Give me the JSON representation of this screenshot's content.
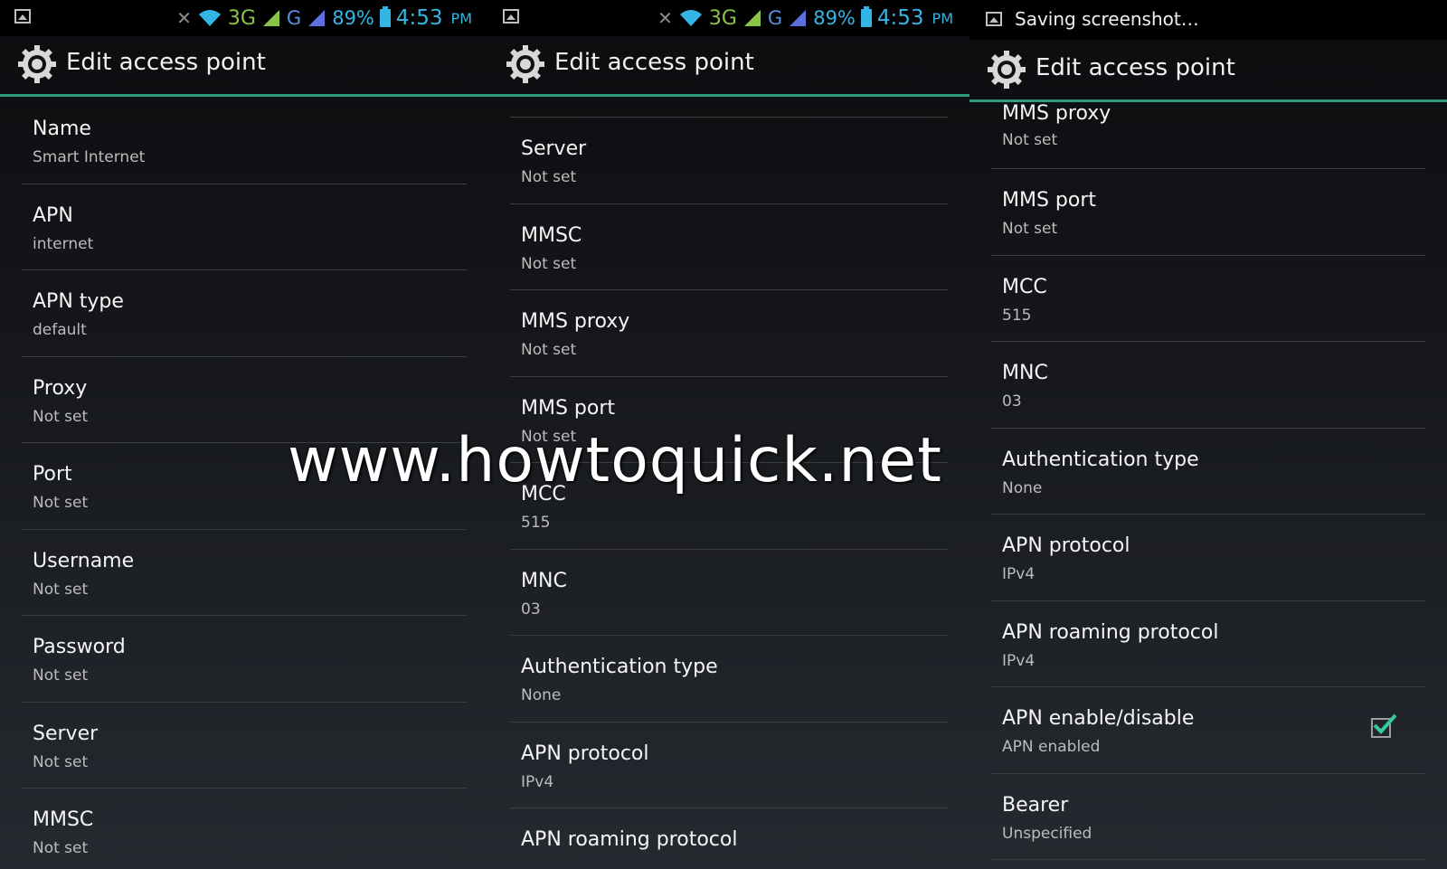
{
  "panels": [
    {
      "status": {
        "bt": "3G",
        "g": "G",
        "battery": "89%",
        "time": "4:53",
        "ampm": "PM"
      },
      "title": "Edit access point",
      "items": [
        {
          "title": "Name",
          "sub": "Smart Internet"
        },
        {
          "title": "APN",
          "sub": "internet"
        },
        {
          "title": "APN type",
          "sub": "default"
        },
        {
          "title": "Proxy",
          "sub": "Not set"
        },
        {
          "title": "Port",
          "sub": "Not set"
        },
        {
          "title": "Username",
          "sub": "Not set"
        },
        {
          "title": "Password",
          "sub": "Not set"
        },
        {
          "title": "Server",
          "sub": "Not set"
        },
        {
          "title": "MMSC",
          "sub": "Not set"
        }
      ]
    },
    {
      "status": {
        "bt": "3G",
        "g": "G",
        "battery": "89%",
        "time": "4:53",
        "ampm": "PM"
      },
      "title": "Edit access point",
      "items": [
        {
          "title": "Server",
          "sub": "Not set"
        },
        {
          "title": "MMSC",
          "sub": "Not set"
        },
        {
          "title": "MMS proxy",
          "sub": "Not set"
        },
        {
          "title": "MMS port",
          "sub": "Not set"
        },
        {
          "title": "MCC",
          "sub": "515"
        },
        {
          "title": "MNC",
          "sub": "03"
        },
        {
          "title": "Authentication type",
          "sub": "None"
        },
        {
          "title": "APN protocol",
          "sub": "IPv4"
        },
        {
          "title": "APN roaming protocol",
          "sub": ""
        }
      ]
    },
    {
      "status": {
        "saving": "Saving screenshot…"
      },
      "title": "Edit access point",
      "items": [
        {
          "title": "MMS proxy",
          "sub": "Not set"
        },
        {
          "title": "MMS port",
          "sub": "Not set"
        },
        {
          "title": "MCC",
          "sub": "515"
        },
        {
          "title": "MNC",
          "sub": "03"
        },
        {
          "title": "Authentication type",
          "sub": "None"
        },
        {
          "title": "APN protocol",
          "sub": "IPv4"
        },
        {
          "title": "APN roaming protocol",
          "sub": "IPv4"
        },
        {
          "title": "APN enable/disable",
          "sub": "APN enabled",
          "checked": true
        },
        {
          "title": "Bearer",
          "sub": "Unspecified"
        }
      ]
    }
  ],
  "watermark": "www.howtoquick.net",
  "colors": {
    "accent": "#2e9c7b",
    "status_blue": "#33b5e5",
    "status_green": "#8bc34a",
    "check": "#33cc99"
  }
}
